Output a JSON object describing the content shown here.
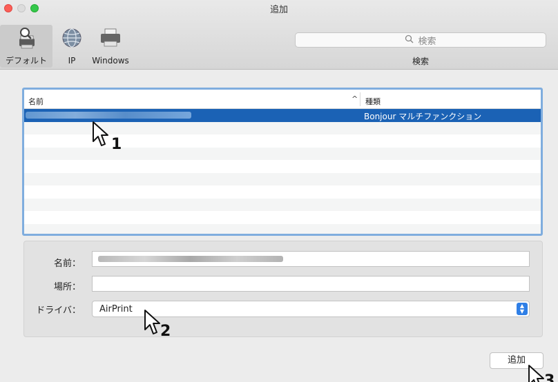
{
  "window": {
    "title": "追加"
  },
  "toolbar": {
    "buttons": [
      {
        "label": "デフォルト",
        "icon": "default-printer-icon"
      },
      {
        "label": "IP",
        "icon": "globe-icon"
      },
      {
        "label": "Windows",
        "icon": "windows-printer-icon"
      }
    ],
    "search": {
      "placeholder": "検索",
      "caption": "検索"
    }
  },
  "list": {
    "columns": {
      "name": "名前",
      "kind": "種類"
    },
    "rows": [
      {
        "name": "",
        "kind": "Bonjour マルチファンクション",
        "selected": true
      }
    ]
  },
  "details": {
    "name_label": "名前：",
    "location_label": "場所：",
    "driver_label": "ドライバ：",
    "driver_value": "AirPrint"
  },
  "buttons": {
    "add_label": "追加"
  },
  "callouts": [
    "1",
    "2",
    "3"
  ],
  "colors": {
    "accent": "#1b62b5",
    "selection_border": "#7fadde"
  }
}
